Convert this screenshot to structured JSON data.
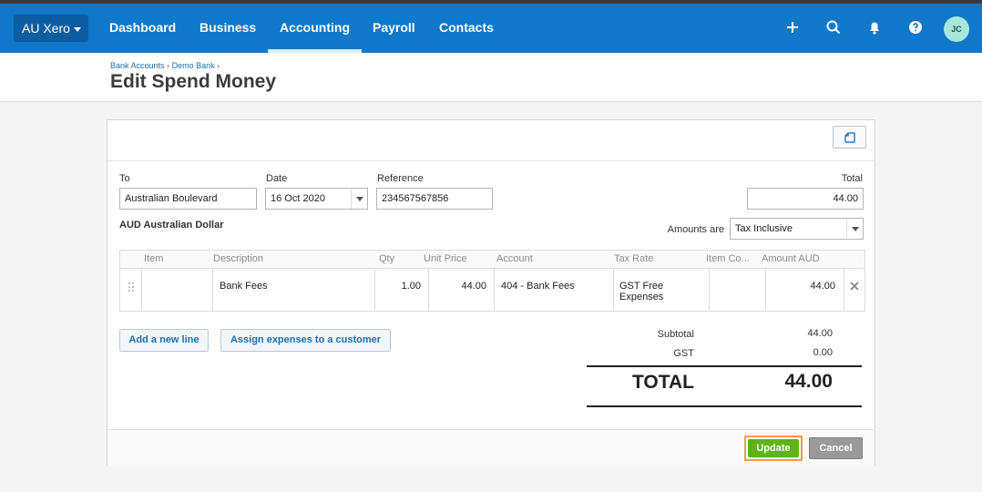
{
  "nav": {
    "org": "AU Xero",
    "items": [
      "Dashboard",
      "Business",
      "Accounting",
      "Payroll",
      "Contacts"
    ],
    "active": "Accounting",
    "icons": [
      "plus-icon",
      "search-icon",
      "bell-icon",
      "help-icon"
    ],
    "avatar": "JC"
  },
  "header": {
    "breadcrumb": [
      "Bank Accounts",
      "Demo Bank"
    ],
    "separator": "›",
    "title": "Edit Spend Money"
  },
  "form": {
    "to_label": "To",
    "to_value": "Australian Boulevard",
    "date_label": "Date",
    "date_value": "16 Oct 2020",
    "reference_label": "Reference",
    "reference_value": "234567567856",
    "total_label": "Total",
    "total_value": "44.00",
    "currency": "AUD Australian Dollar",
    "amounts_are_label": "Amounts are",
    "amounts_are_value": "Tax Inclusive"
  },
  "table": {
    "headers": [
      "Item",
      "Description",
      "Qty",
      "Unit Price",
      "Account",
      "Tax Rate",
      "Item Co...",
      "Amount AUD"
    ],
    "rows": [
      {
        "item": "",
        "description": "Bank Fees",
        "qty": "1.00",
        "unit_price": "44.00",
        "account": "404 - Bank Fees",
        "tax_rate_line1": "GST Free",
        "tax_rate_line2": "Expenses",
        "item_code": "",
        "amount": "44.00"
      }
    ]
  },
  "buttons": {
    "add_line": "Add a new line",
    "assign": "Assign expenses to a customer",
    "update": "Update",
    "cancel": "Cancel"
  },
  "totals": {
    "subtotal_label": "Subtotal",
    "subtotal_value": "44.00",
    "gst_label": "GST",
    "gst_value": "0.00",
    "total_label": "TOTAL",
    "total_value": "44.00"
  }
}
